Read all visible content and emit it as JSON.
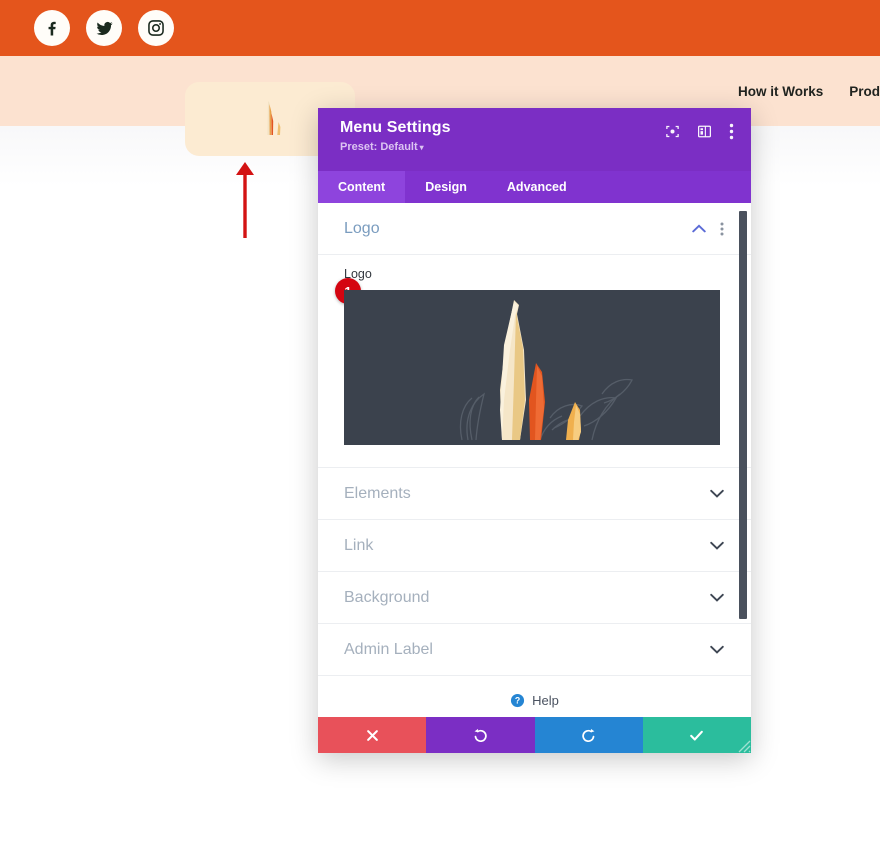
{
  "theme": {
    "orange": "#e4551c",
    "peach": "#fce2d0",
    "logo_card": "#fcebd2",
    "modal_purple": "#7b2ec4",
    "tabbar_purple": "#8033cf",
    "tab_active_purple": "#8e44dd",
    "preview_dark": "#3b424d",
    "badge_red": "#d40511",
    "footer_cancel": "#e8515a",
    "footer_undo": "#7b2ec4",
    "footer_redo": "#2585d3",
    "footer_save": "#2bbd9d",
    "annotation_red": "#d31313"
  },
  "social_bar": {
    "icons": [
      {
        "name": "facebook-icon",
        "label": "Facebook"
      },
      {
        "name": "twitter-icon",
        "label": "Twitter"
      },
      {
        "name": "instagram-icon",
        "label": "Instagram"
      }
    ]
  },
  "site_header": {
    "logo_alt": "Carrots logo",
    "nav": [
      {
        "label": "How it Works"
      },
      {
        "label": "Prod"
      }
    ]
  },
  "annotation": {
    "arrow": "up-arrow",
    "step_badge": "1"
  },
  "modal": {
    "title": "Menu Settings",
    "preset_label": "Preset: Default",
    "preset_caret": "▾",
    "header_icons": [
      {
        "name": "focus-icon",
        "label": "Focus"
      },
      {
        "name": "layout-panel-icon",
        "label": "Layout"
      },
      {
        "name": "more-vertical-icon",
        "label": "More options"
      }
    ],
    "tabs": [
      {
        "label": "Content",
        "active": true
      },
      {
        "label": "Design",
        "active": false
      },
      {
        "label": "Advanced",
        "active": false
      }
    ],
    "sections": [
      {
        "label": "Logo",
        "state": "open",
        "icon": "chevron-up-icon"
      },
      {
        "label": "Elements",
        "state": "collapsed",
        "icon": "chevron-down-icon"
      },
      {
        "label": "Link",
        "state": "collapsed",
        "icon": "chevron-down-icon"
      },
      {
        "label": "Background",
        "state": "collapsed",
        "icon": "chevron-down-icon"
      },
      {
        "label": "Admin Label",
        "state": "collapsed",
        "icon": "chevron-down-icon"
      }
    ],
    "logo_field": {
      "label": "Logo",
      "preview_alt": "Carrots and vegetables logo image"
    },
    "help": {
      "label": "Help",
      "icon": "question-mark-icon"
    },
    "footer_buttons": [
      {
        "name": "cancel-button",
        "icon": "close-icon",
        "label": "Cancel"
      },
      {
        "name": "undo-button",
        "icon": "undo-icon",
        "label": "Undo"
      },
      {
        "name": "redo-button",
        "icon": "redo-icon",
        "label": "Redo"
      },
      {
        "name": "save-button",
        "icon": "check-icon",
        "label": "Save"
      }
    ]
  }
}
